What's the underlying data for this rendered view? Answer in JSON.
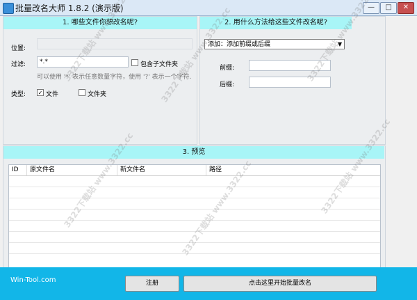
{
  "window": {
    "title": "批量改名大师 1.8.2 (演示版)",
    "min": "—",
    "max": "□",
    "close": "✕"
  },
  "section1": {
    "title": "1. 哪些文件你想改名呢?",
    "location_label": "位置:",
    "filter_label": "过滤:",
    "filter_value": "*.*",
    "include_subfolders": "包含子文件夹",
    "include_subfolders_checked": false,
    "hint": "可以使用 '*' 表示任意数量字符，使用 '?' 表示一个字符.",
    "type_label": "类型:",
    "type_file": "文件",
    "type_file_checked": true,
    "type_folder": "文件夹",
    "type_folder_checked": false
  },
  "section2": {
    "title": "2. 用什么方法给这些文件改名呢?",
    "method": "添加：添加前缀或后缀",
    "prefix_label": "前缀:",
    "suffix_label": "后缀:"
  },
  "section3": {
    "title": "3. 预览",
    "columns": [
      "ID",
      "原文件名",
      "新文件名",
      "路径"
    ]
  },
  "footer": {
    "brand": "Win-Tool.com",
    "register": "注册",
    "start": "点击这里开始批量改名"
  },
  "watermark": "3322下载站 www.3322.cc"
}
